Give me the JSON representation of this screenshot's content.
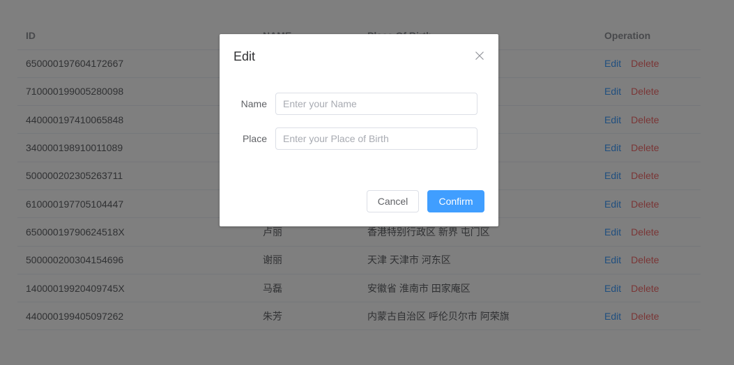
{
  "table": {
    "headers": {
      "id": "ID",
      "name": "NAME",
      "place": "Place Of Birth",
      "operation": "Operation"
    },
    "rows": [
      {
        "id": "650000197604172667",
        "name": "",
        "place": ""
      },
      {
        "id": "710000199005280098",
        "name": "",
        "place": ""
      },
      {
        "id": "440000197410065848",
        "name": "",
        "place": ""
      },
      {
        "id": "340000198910011089",
        "name": "",
        "place": ""
      },
      {
        "id": "500000202305263711",
        "name": "",
        "place": ""
      },
      {
        "id": "610000197705104447",
        "name": "",
        "place": ""
      },
      {
        "id": "65000019790624518X",
        "name": "卢丽",
        "place": "香港特别行政区 新界 屯门区"
      },
      {
        "id": "500000200304154696",
        "name": "谢丽",
        "place": "天津 天津市 河东区"
      },
      {
        "id": "14000019920409745X",
        "name": "马磊",
        "place": "安徽省 淮南市 田家庵区"
      },
      {
        "id": "440000199405097262",
        "name": "朱芳",
        "place": "内蒙古自治区 呼伦贝尔市 阿荣旗"
      }
    ],
    "edit_label": "Edit",
    "delete_label": "Delete"
  },
  "dialog": {
    "title": "Edit",
    "name_label": "Name",
    "name_placeholder": "Enter your Name",
    "name_value": "",
    "place_label": "Place",
    "place_placeholder": "Enter your Place of Birth",
    "place_value": "",
    "cancel_label": "Cancel",
    "confirm_label": "Confirm"
  },
  "icons": {
    "close": "close-icon"
  },
  "colors": {
    "primary": "#409eff",
    "danger": "#f56c6c",
    "overlay": "rgba(0,0,0,0.5)"
  }
}
